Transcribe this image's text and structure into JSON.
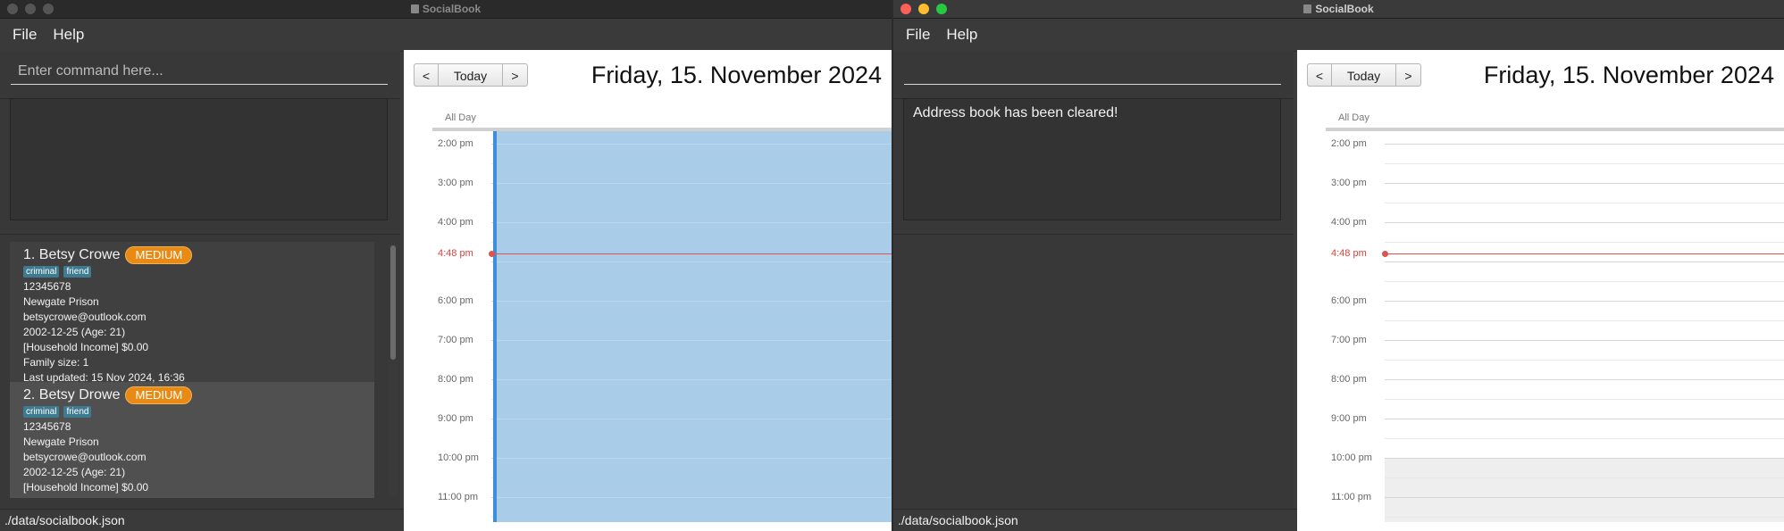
{
  "app_title": "SocialBook",
  "menu": {
    "file": "File",
    "help": "Help"
  },
  "left_window": {
    "command": {
      "value": "",
      "placeholder": "Enter command here..."
    },
    "result": "",
    "persons": [
      {
        "name": "1. Betsy Crowe",
        "priority": "MEDIUM",
        "tags": [
          "criminal",
          "friend"
        ],
        "phone": "12345678",
        "address": "Newgate Prison",
        "email": "betsycrowe@outlook.com",
        "dob": "2002-12-25 (Age: 21)",
        "income": "[Household Income] $0.00",
        "family": "Family size: 1",
        "updated": "Last updated: 15 Nov 2024, 16:36"
      },
      {
        "name": "2. Betsy Drowe",
        "priority": "MEDIUM",
        "tags": [
          "criminal",
          "friend"
        ],
        "phone": "12345678",
        "address": "Newgate Prison",
        "email": "betsycrowe@outlook.com",
        "dob": "2002-12-25 (Age: 21)",
        "income": "[Household Income] $0.00",
        "family": "",
        "updated": ""
      }
    ],
    "status": "./data/socialbook.json"
  },
  "right_window": {
    "command": {
      "value": "",
      "placeholder": ""
    },
    "result": "Address book has been cleared!",
    "status": "./data/socialbook.json"
  },
  "calendar": {
    "prev": "<",
    "today": "Today",
    "next": ">",
    "date": "Friday, 15. November 2024",
    "all_day": "All Day",
    "times": [
      "2:00 pm",
      "3:00 pm",
      "4:00 pm",
      "6:00 pm",
      "7:00 pm",
      "8:00 pm",
      "9:00 pm",
      "10:00 pm",
      "11:00 pm"
    ],
    "now_label": "4:48 pm",
    "now_color": "#d9413b",
    "event_color": "#a9cde9"
  }
}
